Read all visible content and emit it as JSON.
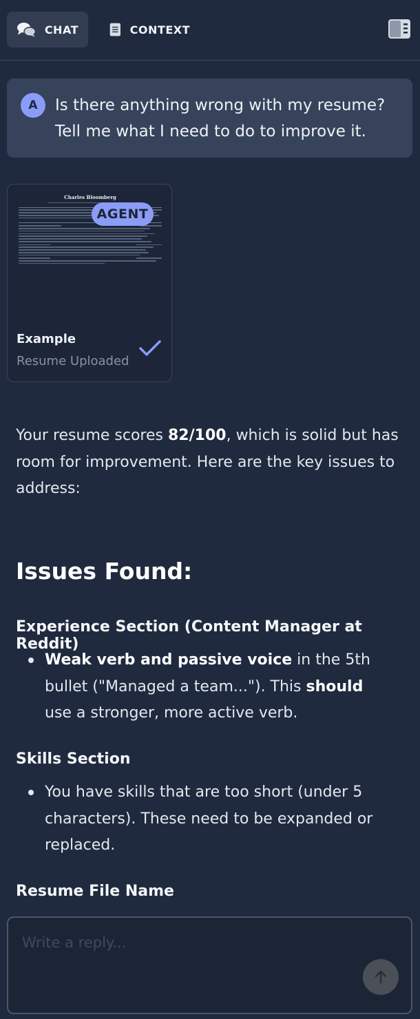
{
  "header": {
    "tabs": [
      {
        "label": "CHAT",
        "icon": "chat-bubbles-icon",
        "active": true
      },
      {
        "label": "CONTEXT",
        "icon": "document-icon",
        "active": false
      }
    ],
    "sidebar_toggle_icon": "sidebar-toggle-icon"
  },
  "user_message": {
    "avatar_initial": "A",
    "text": "Is there anything wrong with my resume? Tell me what I need to do to improve it."
  },
  "resume_card": {
    "preview_name": "Charles Bloomberg",
    "badge": "AGENT",
    "title": "Example",
    "subtitle": "Resume Uploaded",
    "status_icon": "checkmark-icon"
  },
  "response": {
    "intro_before": "Your resume scores ",
    "score": "82/100",
    "intro_after": ", which is solid but has room for improvement. Here are the key issues to address:",
    "issues_heading": "Issues Found:",
    "sections": [
      {
        "heading": "Experience Section (Content Manager at Reddit)",
        "bullet_bold1": "Weak verb and passive voice",
        "bullet_text1": " in the 5th bullet (\"Managed a team...\"). This ",
        "bullet_bold2": "should",
        "bullet_text2": " use a stronger, more active verb."
      },
      {
        "heading": "Skills Section",
        "bullet_text": "You have skills that are too short (under 5 characters). These need to be expanded or replaced."
      },
      {
        "heading": "Resume File Name"
      }
    ]
  },
  "reply": {
    "placeholder": "Write a reply...",
    "send_icon": "arrow-up-icon"
  },
  "colors": {
    "background": "#1f2a3e",
    "accent": "#8b9cf7",
    "message_bg": "#36435a"
  }
}
